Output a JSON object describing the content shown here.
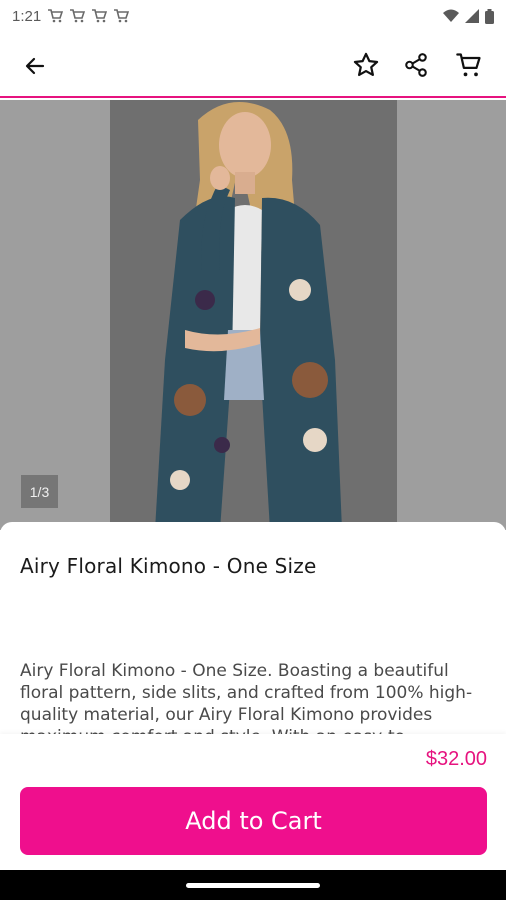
{
  "status_bar": {
    "time": "1:21",
    "notification_icons": [
      "cart-notification-icon",
      "cart-notification-icon",
      "cart-notification-icon",
      "cart-notification-icon"
    ],
    "system_icons": [
      "wifi-icon",
      "signal-icon",
      "battery-icon"
    ]
  },
  "toolbar": {
    "back_icon": "arrow-left-icon",
    "favorite_icon": "star-outline-icon",
    "share_icon": "share-icon",
    "cart_icon": "cart-icon"
  },
  "gallery": {
    "page_indicator": "1/3"
  },
  "product": {
    "title": "Airy Floral Kimono - One Size",
    "description": "Airy Floral Kimono - One Size. Boasting a beautiful floral pattern, side slits, and crafted from 100% high-quality material, our Airy Floral Kimono provides maximum comfort and style. With an easy-to-",
    "price": "$32.00"
  },
  "actions": {
    "add_to_cart_label": "Add to Cart"
  },
  "colors": {
    "brand": "#ef0f8d",
    "price": "#e6137f",
    "kimono": "#2f4f5f"
  }
}
